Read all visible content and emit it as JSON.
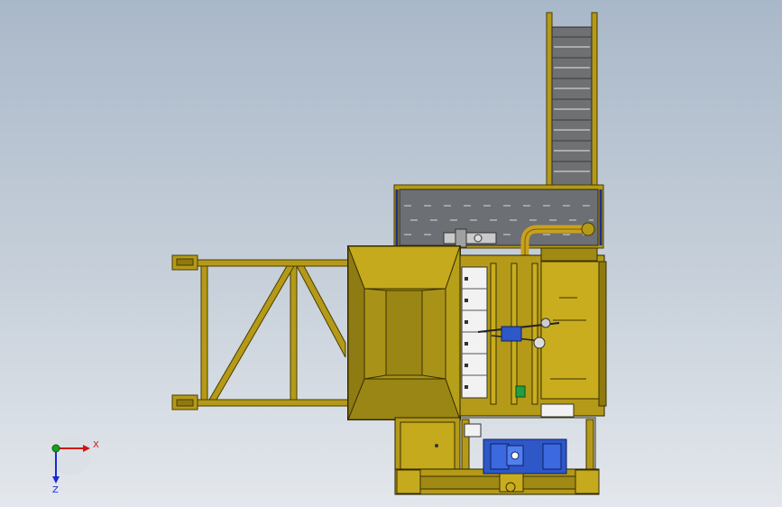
{
  "viewport": {
    "background_top": "#a9b8c9",
    "background_bottom": "#e3e7ec"
  },
  "model": {
    "frame_color": "#b49a18",
    "frame_dark": "#5a4a00",
    "hopper_color": "#a89318",
    "belt_color": "#6f7072",
    "motor_color": "#2e57c8",
    "pipe_color": "#c9a11e",
    "module_color": "#f2f2f2"
  },
  "triad": {
    "x_label": "X",
    "z_label": "Z",
    "x_color": "#d01414",
    "z_color": "#1a2bd0",
    "y_color": "#18a018",
    "icon": "coordinate-triad-icon"
  }
}
